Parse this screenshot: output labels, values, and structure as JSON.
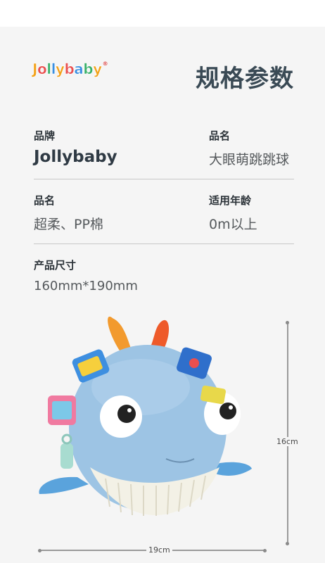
{
  "brand": {
    "logo_text": "Jollybaby",
    "logo_colors": [
      "#f2a21b",
      "#e94f4f",
      "#3ab06a",
      "#3a8fe0",
      "#f2a21b",
      "#e94f4f",
      "#3a8fe0",
      "#3ab06a",
      "#f2a21b"
    ]
  },
  "header": {
    "title": "规格参数"
  },
  "specs": {
    "brand_label": "品牌",
    "brand_value": "Jollybaby",
    "product_name_label": "品名",
    "product_name_value": "大眼萌跳跳球",
    "material_label": "品名",
    "material_value": "超柔、PP棉",
    "age_label": "适用年龄",
    "age_value": "0m以上",
    "size_label": "产品尺寸",
    "size_value": "160mm*190mm"
  },
  "dimensions": {
    "height": "16cm",
    "width": "19cm"
  },
  "colors": {
    "title": "#3a4a55",
    "panel": "#f5f5f5",
    "toy_body": "#9dc4e4",
    "toy_belly": "#f3f1e6"
  }
}
